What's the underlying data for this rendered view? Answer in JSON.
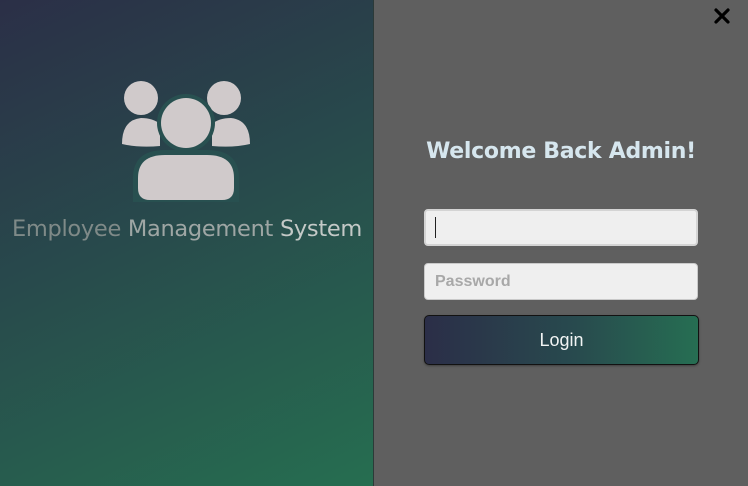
{
  "brand": {
    "icon": "users-group-icon",
    "title_words": [
      "Employee",
      "Management",
      "System"
    ]
  },
  "login": {
    "heading": "Welcome Back Admin!",
    "username": {
      "value": "",
      "placeholder": ""
    },
    "password": {
      "value": "",
      "placeholder": "Password"
    },
    "button_label": "Login"
  },
  "window": {
    "close_icon": "close-icon"
  },
  "colors": {
    "gradient_start": "#2b2f47",
    "gradient_end": "#266e50",
    "right_panel_bg": "#5f5f5f",
    "heading_color": "#d6e6ee",
    "icon_color": "#d0cacb"
  }
}
